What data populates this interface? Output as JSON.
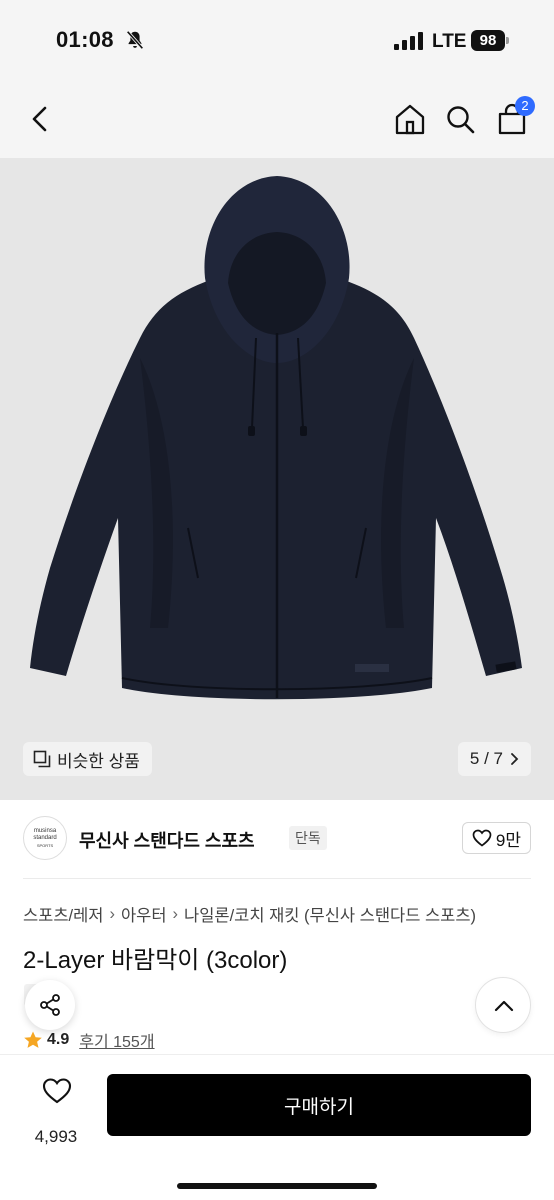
{
  "status_bar": {
    "time": "01:08",
    "network": "LTE",
    "battery": "98"
  },
  "nav": {
    "cart_count": "2"
  },
  "gallery": {
    "similar_label": "비슷한 상품",
    "page_indicator": "5 / 7"
  },
  "brand": {
    "logo_line1": "musinsa",
    "logo_line2": "standard",
    "logo_line3": "SPORTS",
    "name": "무신사 스탠다드 스포츠",
    "tag": "단독",
    "likes": "9만"
  },
  "breadcrumb": [
    "스포츠/레저",
    "아우터",
    "나일론/코치 재킷 (무신사 스탠다드 스포츠)"
  ],
  "product": {
    "title": "2-Layer 바람막이 (3color)",
    "tag": "단독",
    "rating": "4.9",
    "reviews": "후기 155개"
  },
  "bottom": {
    "wish_count": "4,993",
    "buy_label": "구매하기"
  },
  "colors": {
    "accent": "#2f6bff",
    "jacket": "#1c2130",
    "star": "#f5a623"
  }
}
